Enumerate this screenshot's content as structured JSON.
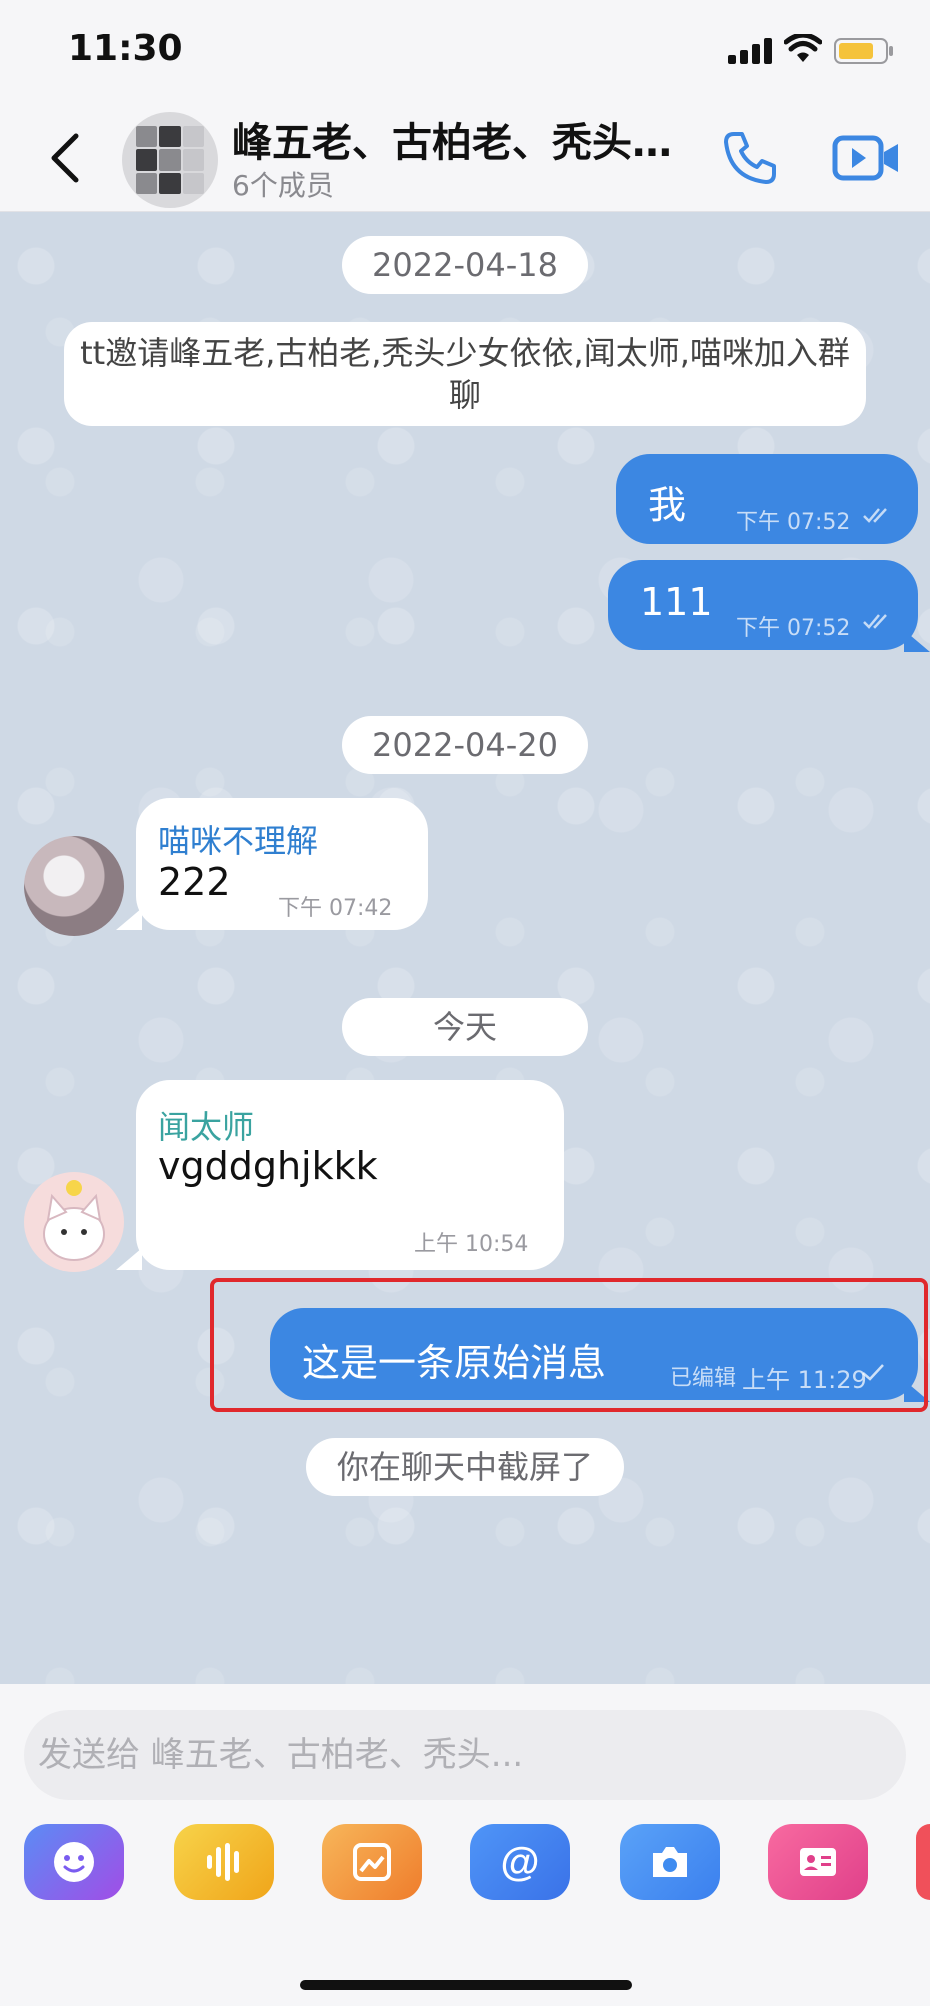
{
  "status_bar": {
    "time": "11:30"
  },
  "header": {
    "title": "峰五老、古柏老、秃头…",
    "subtitle": "6个成员"
  },
  "messages": {
    "date1": "2022-04-18",
    "system_invite": "tt邀请峰五老,古柏老,秃头少女依依,闻太师,喵咪加入群聊",
    "out1": {
      "text": "我",
      "time": "下午 07:52"
    },
    "out2": {
      "text": "111",
      "time": "下午 07:52"
    },
    "date2": "2022-04-20",
    "in1": {
      "sender": "喵咪不理解",
      "text": "222",
      "time": "下午 07:42"
    },
    "date3": "今天",
    "in2": {
      "sender": "闻太师",
      "text": "vgddghjkkk",
      "time": "上午 10:54"
    },
    "out3": {
      "text": "这是一条原始消息",
      "edited": "已编辑",
      "time": "上午 11:29"
    },
    "system_screenshot": "你在聊天中截屏了"
  },
  "input": {
    "placeholder": "发送给 峰五老、古柏老、秃头..."
  },
  "toolbar": [
    {
      "icon": "emoji-icon",
      "color": "#7a5cf0"
    },
    {
      "icon": "voice-icon",
      "color": "#f3b51d"
    },
    {
      "icon": "image-icon",
      "color": "#f29a3a"
    },
    {
      "icon": "mention-icon",
      "color": "#4a8ef5"
    },
    {
      "icon": "camera-icon",
      "color": "#3f8cf0"
    },
    {
      "icon": "contact-card-icon",
      "color": "#f0508f"
    }
  ],
  "colors": {
    "accent": "#3c87e2",
    "chat_background": "#cfd9e5",
    "sender1_name": "#2f7fd0",
    "sender2_name": "#3aa3a0",
    "highlight": "#e0282c"
  }
}
